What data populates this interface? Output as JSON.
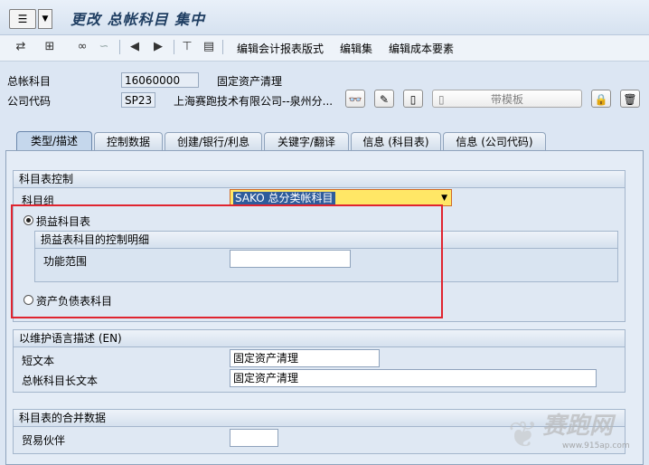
{
  "title": "更改 总帐科目 集中",
  "toolbar": {
    "menu1": "编辑会计报表版式",
    "menu2": "编辑集",
    "menu3": "编辑成本要素"
  },
  "header": {
    "gl_account_label": "总帐科目",
    "gl_account_value": "16060000",
    "gl_account_desc": "固定资产清理",
    "company_label": "公司代码",
    "company_value": "SP23",
    "company_desc": "上海赛跑技术有限公司--泉州分...",
    "template_button": "带模板"
  },
  "tabs": [
    "类型/描述",
    "控制数据",
    "创建/银行/利息",
    "关键字/翻译",
    "信息 (科目表)",
    "信息 (公司代码)"
  ],
  "group1": {
    "title": "科目表控制",
    "account_group_label": "科目组",
    "account_group_value": "SAKO 总分类帐科目",
    "pl_radio_label": "损益科目表",
    "pl_subgroup_title": "损益表科目的控制明细",
    "functional_area_label": "功能范围",
    "functional_area_value": "",
    "bs_radio_label": "资产负债表科目"
  },
  "group2": {
    "title": "以维护语言描述 (EN)",
    "short_text_label": "短文本",
    "short_text_value": "固定资产清理",
    "long_text_label": "总帐科目长文本",
    "long_text_value": "固定资产清理"
  },
  "group3": {
    "title": "科目表的合并数据",
    "trading_partner_label": "贸易伙伴",
    "trading_partner_value": ""
  },
  "watermark": {
    "text": "赛跑网",
    "url": "www.915ap.com"
  }
}
